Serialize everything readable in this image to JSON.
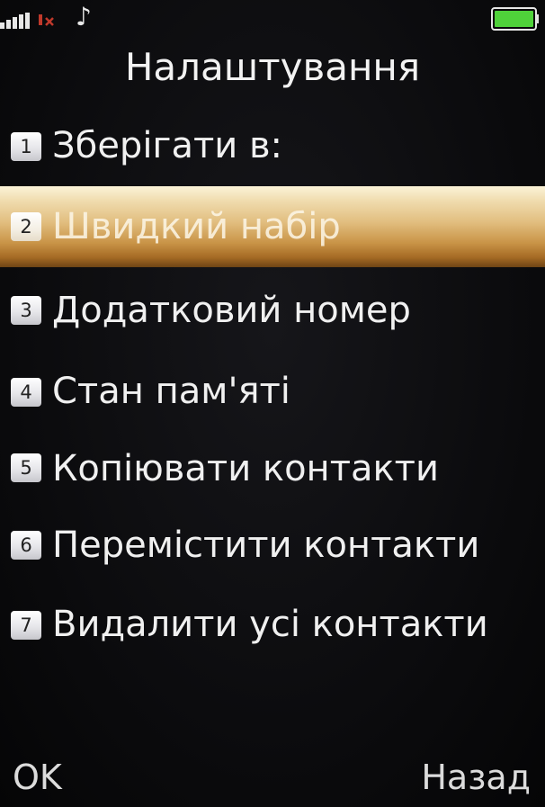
{
  "status_bar": {
    "signal_icon": "signal-strength-icon",
    "no_call_icon": "missed-call-icon",
    "music_icon": "music-note-icon",
    "battery_icon": "battery-full-icon",
    "battery_level": 1.0,
    "battery_color": "#4fd23a"
  },
  "header": {
    "title": "Налаштування"
  },
  "menu": {
    "selected_index": 1,
    "highlight_color": "#d9ac62",
    "items": [
      {
        "number": "1",
        "label": "Зберігати в:"
      },
      {
        "number": "2",
        "label": "Швидкий набір"
      },
      {
        "number": "3",
        "label": "Додатковий номер"
      },
      {
        "number": "4",
        "label": "Стан пам'яті"
      },
      {
        "number": "5",
        "label": "Копіювати контакти"
      },
      {
        "number": "6",
        "label": "Перемістити контакти"
      },
      {
        "number": "7",
        "label": "Видалити усі контакти"
      }
    ]
  },
  "softkeys": {
    "left": "OK",
    "right": "Назад"
  }
}
